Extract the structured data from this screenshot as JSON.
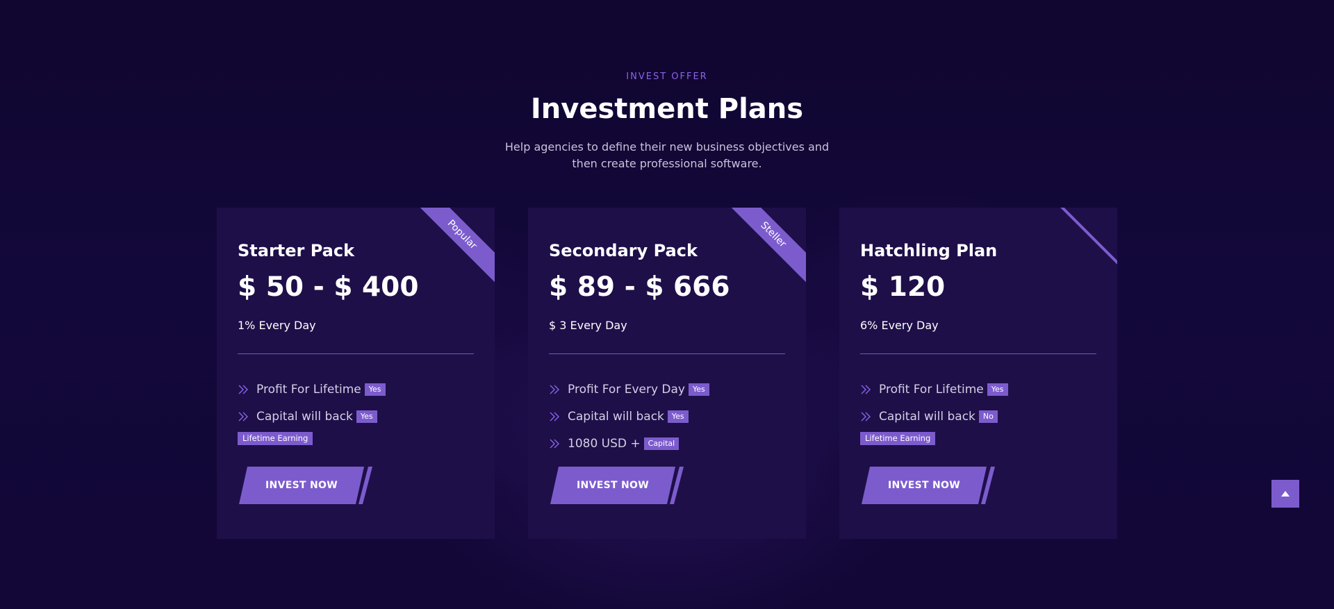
{
  "header": {
    "eyebrow": "INVEST OFFER",
    "title": "Investment Plans",
    "subtitle": "Help agencies to define their new business objectives and then create professional software."
  },
  "plans": [
    {
      "ribbon": "Popular",
      "name": "Starter Pack",
      "price": "$ 50 - $ 400",
      "rate": "1% Every Day",
      "features": [
        {
          "text": "Profit For Lifetime",
          "badge": "Yes"
        },
        {
          "text": "Capital will back",
          "badge": "Yes"
        }
      ],
      "tag": "Lifetime Earning",
      "button": "INVEST NOW"
    },
    {
      "ribbon": "Steller",
      "name": "Secondary Pack",
      "price": "$ 89 - $ 666",
      "rate": "$ 3 Every Day",
      "features": [
        {
          "text": "Profit For Every Day",
          "badge": "Yes"
        },
        {
          "text": "Capital will back",
          "badge": "Yes"
        },
        {
          "text": "1080 USD +",
          "badge": "Capital"
        }
      ],
      "button": "INVEST NOW"
    },
    {
      "ribbon": "",
      "name": "Hatchling Plan",
      "price": "$ 120",
      "rate": "6% Every Day",
      "features": [
        {
          "text": "Profit For Lifetime",
          "badge": "Yes"
        },
        {
          "text": "Capital will back",
          "badge": "No"
        }
      ],
      "tag": "Lifetime Earning",
      "button": "INVEST NOW"
    }
  ],
  "icons": {
    "feature_bullet": "double-chevron-right-icon",
    "scroll_top": "caret-up-icon"
  },
  "colors": {
    "background": "#110632",
    "card": "#1e0f49",
    "accent": "#7c5ccd",
    "eyebrow": "#8b64e8"
  }
}
